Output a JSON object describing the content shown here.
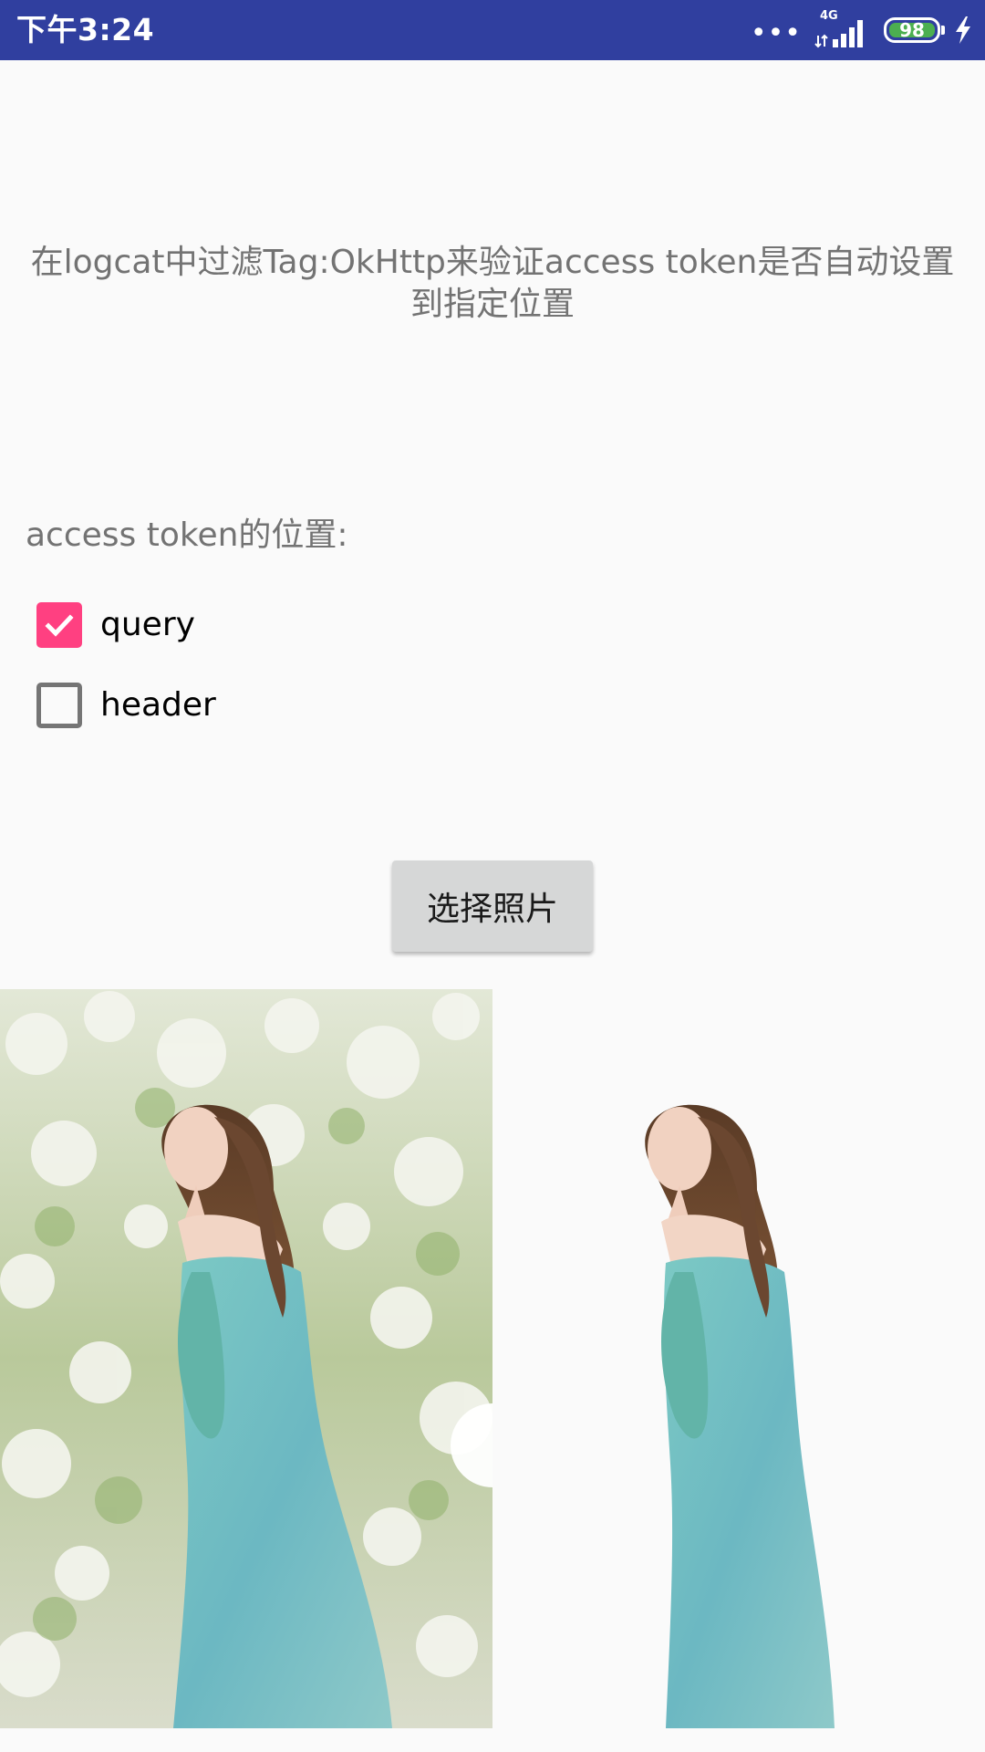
{
  "status_bar": {
    "time": "下午3:24",
    "overflow_dots": "•••",
    "network_type": "4G",
    "battery_level": "98",
    "colors": {
      "background": "#303f9f",
      "battery": "#4caf50"
    }
  },
  "main": {
    "instruction": "在logcat中过滤Tag:OkHttp来验证access token是否自动设置到指定位置",
    "position_label": "access token的位置:",
    "options": [
      {
        "label": "query",
        "checked": true
      },
      {
        "label": "header",
        "checked": false
      }
    ],
    "select_photo_button": "选择照片",
    "accent_color": "#ff4081"
  },
  "images": {
    "original": "photo of woman in light blue off-shoulder dress in front of white blossoms",
    "processed": "same woman with background removed"
  }
}
